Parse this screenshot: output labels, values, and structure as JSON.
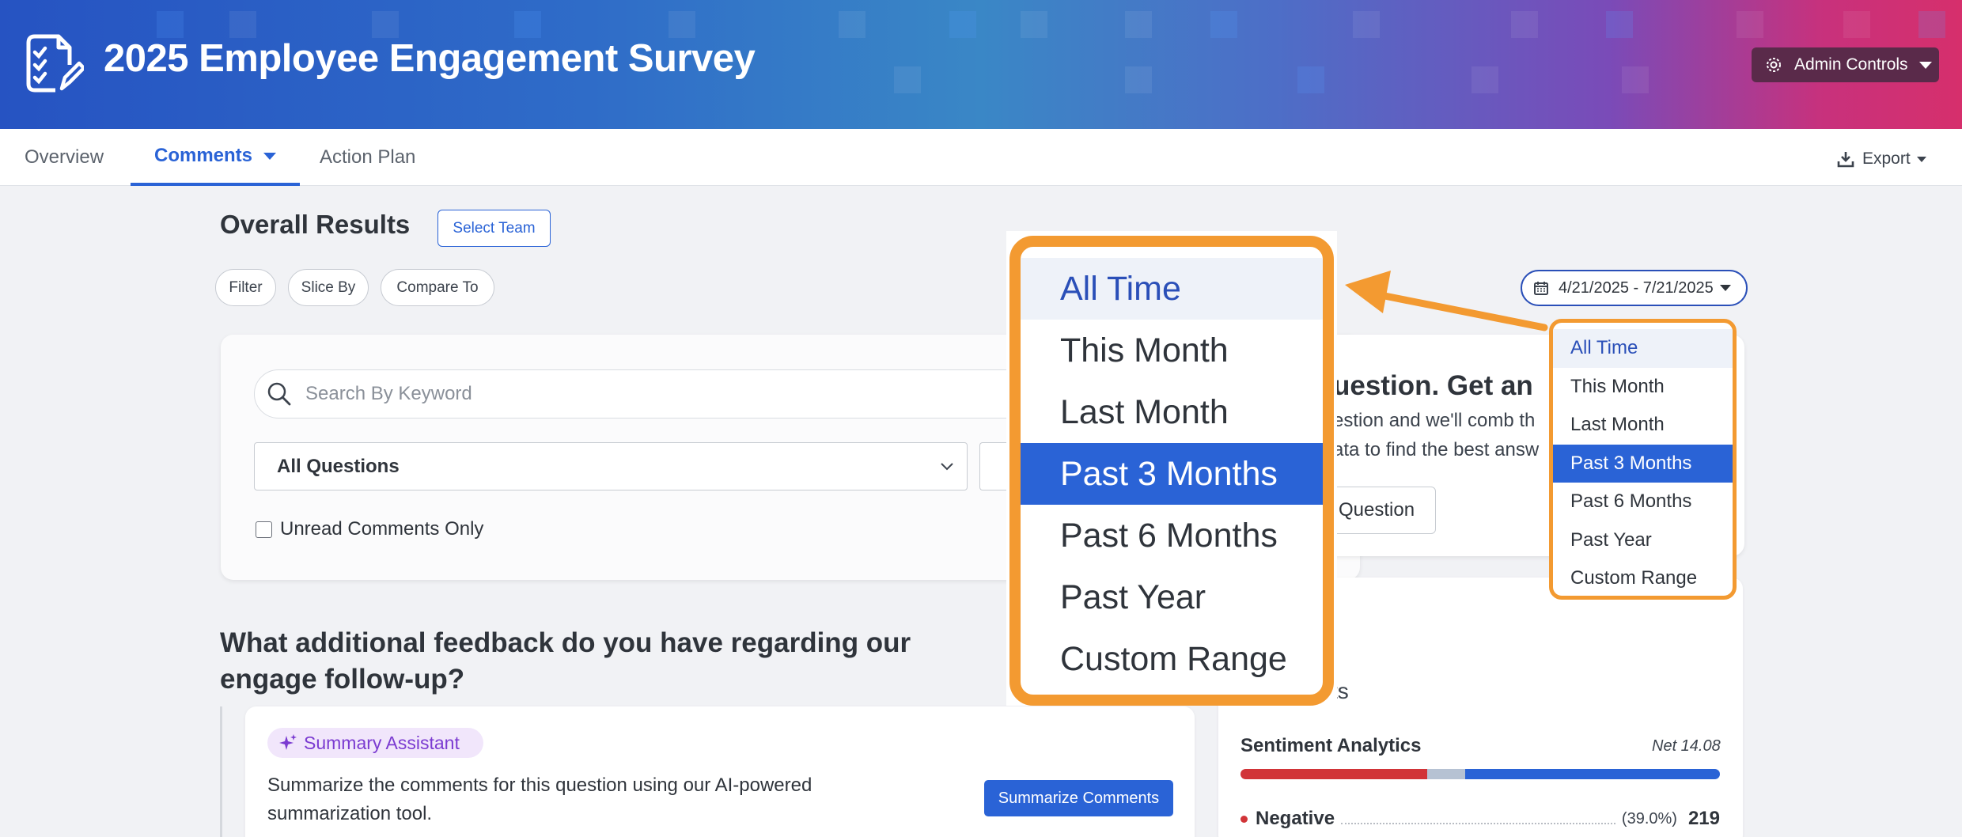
{
  "header": {
    "title": "2025 Employee Engagement Survey",
    "icon": "survey-checklist-icon",
    "admin_label": "Admin Controls"
  },
  "nav": {
    "tabs": [
      {
        "label": "Overview"
      },
      {
        "label": "Comments"
      },
      {
        "label": "Action Plan"
      }
    ],
    "export_label": "Export"
  },
  "toolbar": {
    "heading": "Overall Results",
    "select_team": "Select Team",
    "filters": [
      "Filter",
      "Slice By",
      "Compare To"
    ],
    "date_range": "4/21/2025 - 7/21/2025"
  },
  "search": {
    "placeholder": "Search By Keyword",
    "questions_select": "All Questions",
    "unread_label": "Unread Comments Only"
  },
  "ai_card": {
    "title_fragment": "uestion. Get an",
    "line1": "estion and we'll comb th",
    "line2": "ata to find the best answ",
    "button_fragment": "Question"
  },
  "question": {
    "text": "What additional feedback do you have regarding our engage follow-up?"
  },
  "summary": {
    "badge": "Summary Assistant",
    "text": "Summarize the comments for this question using our AI-powered summarization tool.",
    "button": "Summarize Comments"
  },
  "sentiment": {
    "partial_label": "ts",
    "title": "Sentiment Analytics",
    "net": "Net 14.08",
    "negative_fraction": 0.39,
    "neutral_fraction": 0.078,
    "negative_label": "Negative",
    "negative_pct": "(39.0%)",
    "negative_count": "219"
  },
  "date_options": [
    "All Time",
    "This Month",
    "Last Month",
    "Past 3 Months",
    "Past 6 Months",
    "Past Year",
    "Custom Range"
  ],
  "date_hovered": "All Time",
  "date_selected": "Past 3 Months",
  "colors": {
    "accent": "#2a63d6",
    "highlight": "#f39a31",
    "negative": "#d13438"
  }
}
